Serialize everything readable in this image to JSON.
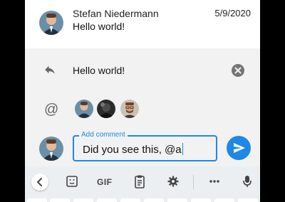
{
  "message": {
    "author": "Stefan Niedermann",
    "date": "5/9/2020",
    "text": "Hello world!"
  },
  "reply_preview": {
    "text": "Hello world!",
    "reply_icon": "reply-icon",
    "close_icon": "close-circle-icon"
  },
  "mentions": {
    "icon": "at-icon",
    "at_symbol": "@"
  },
  "composer": {
    "label": "Add comment",
    "value": "Did you see this, @a",
    "send_icon": "send-icon"
  },
  "keyboard": {
    "gif_label": "GIF",
    "icons": [
      "chevron-left-icon",
      "sticker-icon",
      "clipboard-icon",
      "gear-icon",
      "more-horizontal-icon",
      "microphone-icon"
    ]
  },
  "colors": {
    "accent": "#1e88e5",
    "reply_bg": "#f2f2f2",
    "keyboard_bg": "#eceff1"
  }
}
